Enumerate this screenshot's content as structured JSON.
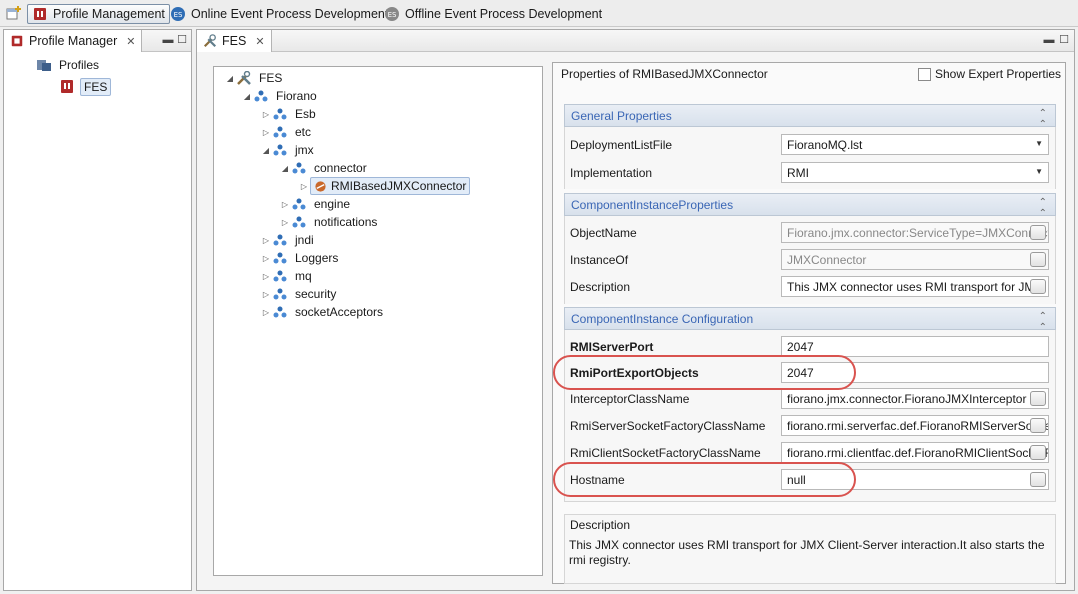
{
  "perspectives": [
    {
      "label": "Profile Management",
      "active": true
    },
    {
      "label": "Online Event Process Development",
      "active": false
    },
    {
      "label": "Offline Event Process Development",
      "active": false
    }
  ],
  "profile_view": {
    "title": "Profile Manager",
    "tree": [
      {
        "label": "Profiles"
      },
      {
        "label": "FES"
      }
    ]
  },
  "fes_view": {
    "title": "FES",
    "tree": [
      {
        "label": "FES",
        "expanded": true
      },
      {
        "label": "Fiorano",
        "expanded": true
      },
      {
        "label": "Esb"
      },
      {
        "label": "etc"
      },
      {
        "label": "jmx",
        "expanded": true
      },
      {
        "label": "connector",
        "expanded": true
      },
      {
        "label": "RMIBasedJMXConnector",
        "selected": true
      },
      {
        "label": "engine"
      },
      {
        "label": "notifications"
      },
      {
        "label": "jndi"
      },
      {
        "label": "Loggers"
      },
      {
        "label": "mq"
      },
      {
        "label": "security"
      },
      {
        "label": "socketAcceptors"
      }
    ]
  },
  "properties": {
    "title": "Properties of RMIBasedJMXConnector",
    "expert_label": "Show Expert Properties",
    "expert_checked": false,
    "sections": [
      {
        "title": "General Properties",
        "rows": [
          {
            "label": "DeploymentListFile",
            "value": "FioranoMQ.lst",
            "type": "combo"
          },
          {
            "label": "Implementation",
            "value": "RMI",
            "type": "combo"
          }
        ]
      },
      {
        "title": "ComponentInstanceProperties",
        "rows": [
          {
            "label": "ObjectName",
            "value": "Fiorano.jmx.connector:ServiceType=JMXConnector",
            "type": "disabled-ellipsis"
          },
          {
            "label": "InstanceOf",
            "value": "JMXConnector",
            "type": "disabled-ellipsis"
          },
          {
            "label": "Description",
            "value": "This JMX connector uses RMI transport for JMX",
            "type": "ellipsis"
          }
        ]
      },
      {
        "title": "ComponentInstance Configuration",
        "rows": [
          {
            "label": "RMIServerPort",
            "value": "2047",
            "type": "text",
            "bold": true
          },
          {
            "label": "RmiPortExportObjects",
            "value": "2047",
            "type": "text",
            "bold": true
          },
          {
            "label": "InterceptorClassName",
            "value": "fiorano.jmx.connector.FioranoJMXInterceptor",
            "type": "ellipsis"
          },
          {
            "label": "RmiServerSocketFactoryClassName",
            "value": "fiorano.rmi.serverfac.def.FioranoRMIServerSocketFactory",
            "type": "ellipsis"
          },
          {
            "label": "RmiClientSocketFactoryClassName",
            "value": "fiorano.rmi.clientfac.def.FioranoRMIClientSocketFactory",
            "type": "ellipsis"
          },
          {
            "label": "Hostname",
            "value": "null",
            "type": "ellipsis"
          }
        ]
      }
    ],
    "description_title": "Description",
    "description_text": "This JMX connector uses RMI transport for JMX Client-Server interaction.It also starts the rmi registry."
  },
  "colors": {
    "section_title": "#3a66b5",
    "highlight": "#d9534f",
    "selection": "#e2ecf8"
  }
}
